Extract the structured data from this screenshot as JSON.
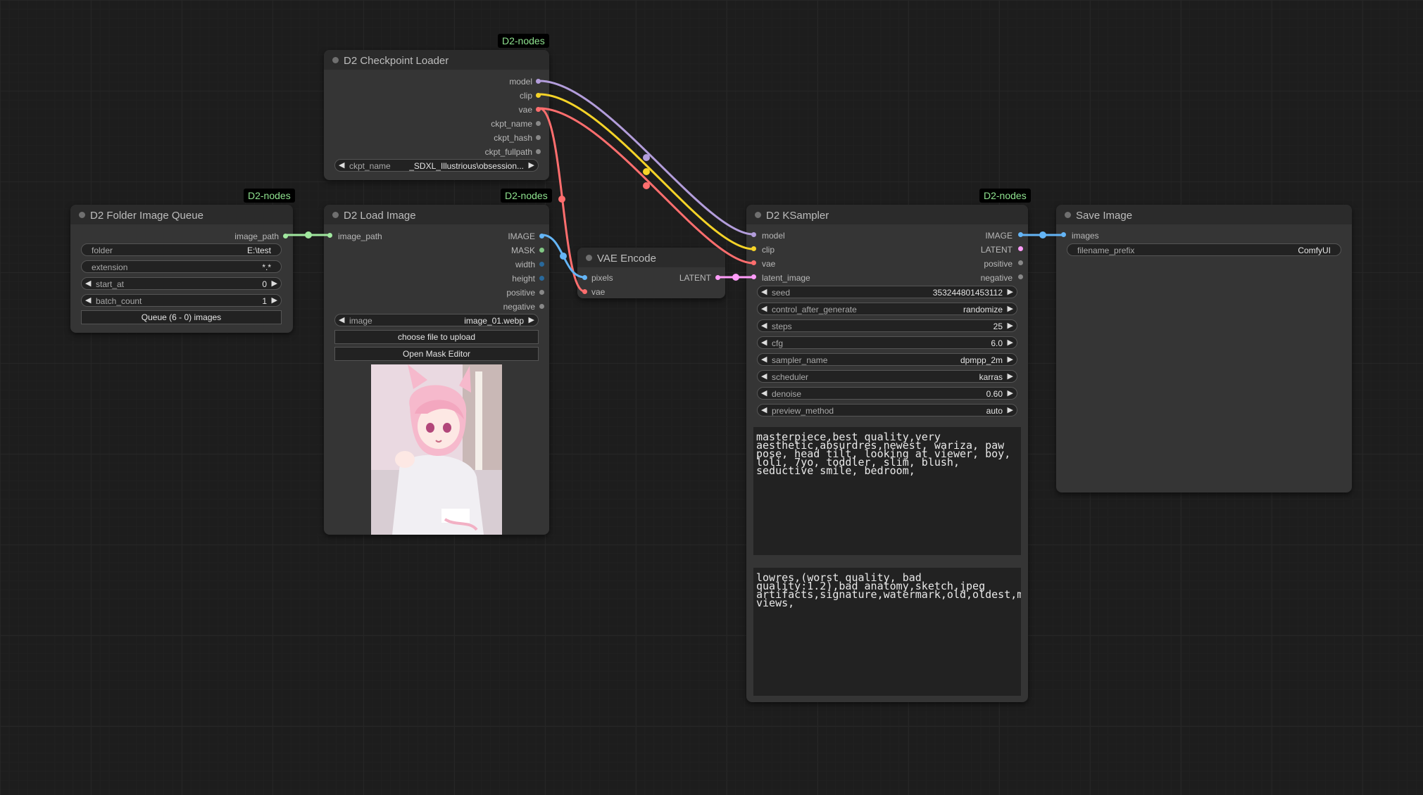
{
  "badge_text": "D2-nodes",
  "nodes": {
    "checkpoint": {
      "title": "D2 Checkpoint Loader",
      "outputs": [
        "model",
        "clip",
        "vae",
        "ckpt_name",
        "ckpt_hash",
        "ckpt_fullpath"
      ],
      "widget_label": "ckpt_name",
      "widget_value": "_SDXL_Illustrious\\obsession..."
    },
    "folder_queue": {
      "title": "D2 Folder Image Queue",
      "output": "image_path",
      "widgets": [
        {
          "label": "folder",
          "value": "E:\\test"
        },
        {
          "label": "extension",
          "value": "*.*"
        },
        {
          "label": "start_at",
          "value": "0"
        },
        {
          "label": "batch_count",
          "value": "1"
        }
      ],
      "button": "Queue (6 - 0) images"
    },
    "load_image": {
      "title": "D2 Load Image",
      "input": "image_path",
      "outputs": [
        "IMAGE",
        "MASK",
        "width",
        "height",
        "positive",
        "negative"
      ],
      "widget_label": "image",
      "widget_value": "image_01.webp",
      "upload_button": "choose file to upload",
      "mask_button": "Open Mask Editor"
    },
    "vae_encode": {
      "title": "VAE Encode",
      "inputs": [
        "pixels",
        "vae"
      ],
      "output": "LATENT"
    },
    "ksampler": {
      "title": "D2 KSampler",
      "inputs": [
        "model",
        "clip",
        "vae",
        "latent_image"
      ],
      "outputs": [
        "IMAGE",
        "LATENT",
        "positive",
        "negative"
      ],
      "widgets": [
        {
          "label": "seed",
          "value": "353244801453112"
        },
        {
          "label": "control_after_generate",
          "value": "randomize"
        },
        {
          "label": "steps",
          "value": "25"
        },
        {
          "label": "cfg",
          "value": "6.0"
        },
        {
          "label": "sampler_name",
          "value": "dpmpp_2m"
        },
        {
          "label": "scheduler",
          "value": "karras"
        },
        {
          "label": "denoise",
          "value": "0.60"
        },
        {
          "label": "preview_method",
          "value": "auto"
        }
      ],
      "positive_prompt": "masterpiece,best quality,very aesthetic,absurdres,newest, wariza, paw pose, head tilt, looking at viewer, boy, loli, 7yo, toddler, slim, blush, seductive smile, bedroom,",
      "negative_prompt": "lowres,(worst quality, bad quality:1.2),bad anatomy,sketch,jpeg artifacts,signature,watermark,old,oldest,multiple views,"
    },
    "save_image": {
      "title": "Save Image",
      "input": "images",
      "widget_label": "filename_prefix",
      "widget_value": "ComfyUI"
    }
  },
  "colors": {
    "model": "#b39ddb",
    "clip": "#f5d328",
    "vae": "#ff6e6e",
    "image": "#64b5f6",
    "latent": "#ff9cf9",
    "string": "#a1e89f"
  }
}
